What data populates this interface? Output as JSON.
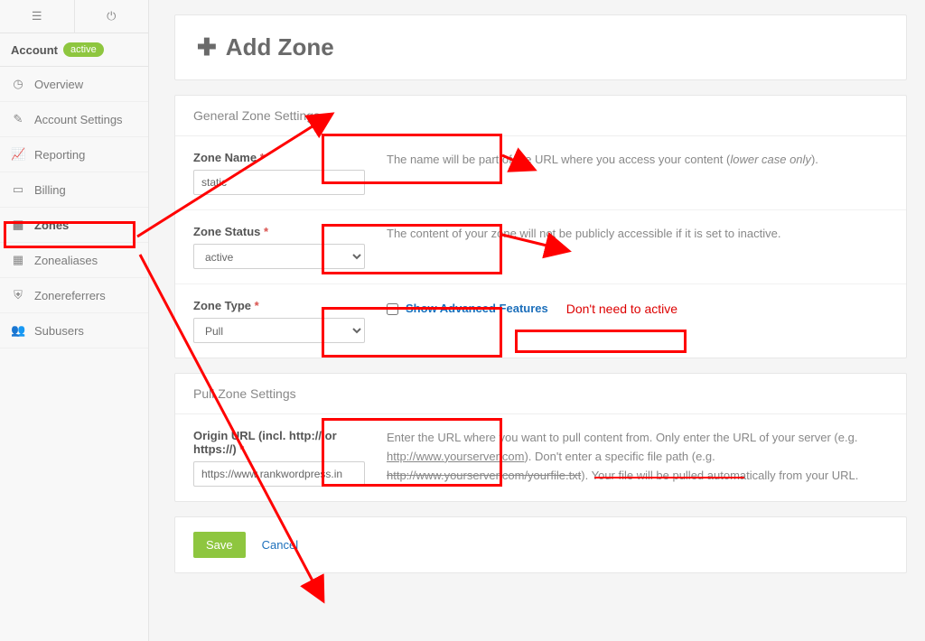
{
  "sidebar": {
    "account_label": "Account",
    "account_badge": "active",
    "items": [
      {
        "label": "Overview"
      },
      {
        "label": "Account Settings"
      },
      {
        "label": "Reporting"
      },
      {
        "label": "Billing"
      },
      {
        "label": "Zones"
      },
      {
        "label": "Zonealiases"
      },
      {
        "label": "Zonereferrers"
      },
      {
        "label": "Subusers"
      }
    ]
  },
  "page_title": "Add Zone",
  "sections": {
    "general": {
      "heading": "General Zone Settings",
      "zone_name": {
        "label": "Zone Name",
        "value": "static",
        "help_a": "The name will be part of the URL where you access your content (",
        "help_b": "lower case only",
        "help_c": ")."
      },
      "zone_status": {
        "label": "Zone Status",
        "value": "active",
        "help": "The content of your zone will not be publicly accessible if it is set to inactive."
      },
      "zone_type": {
        "label": "Zone Type",
        "value": "Pull",
        "adv_label": "Show Advanced Features",
        "annot": "Don't need to active"
      }
    },
    "pull": {
      "heading": "Pull Zone Settings",
      "origin": {
        "label": "Origin URL (incl. http:// or https://)",
        "value": "https://www.rankwordpress.in",
        "help_a": "Enter the URL where you want to pull content from. Only enter the URL of your server (e.g. ",
        "help_b": "http://www.yourserver.com",
        "help_c": "). Don't enter a specific file path (e.g. ",
        "help_d": "http://www.yourserver.com/yourfile.txt",
        "help_e": "). Your file will be pulled automatically from your URL."
      }
    }
  },
  "actions": {
    "save": "Save",
    "cancel": "Cancel"
  }
}
